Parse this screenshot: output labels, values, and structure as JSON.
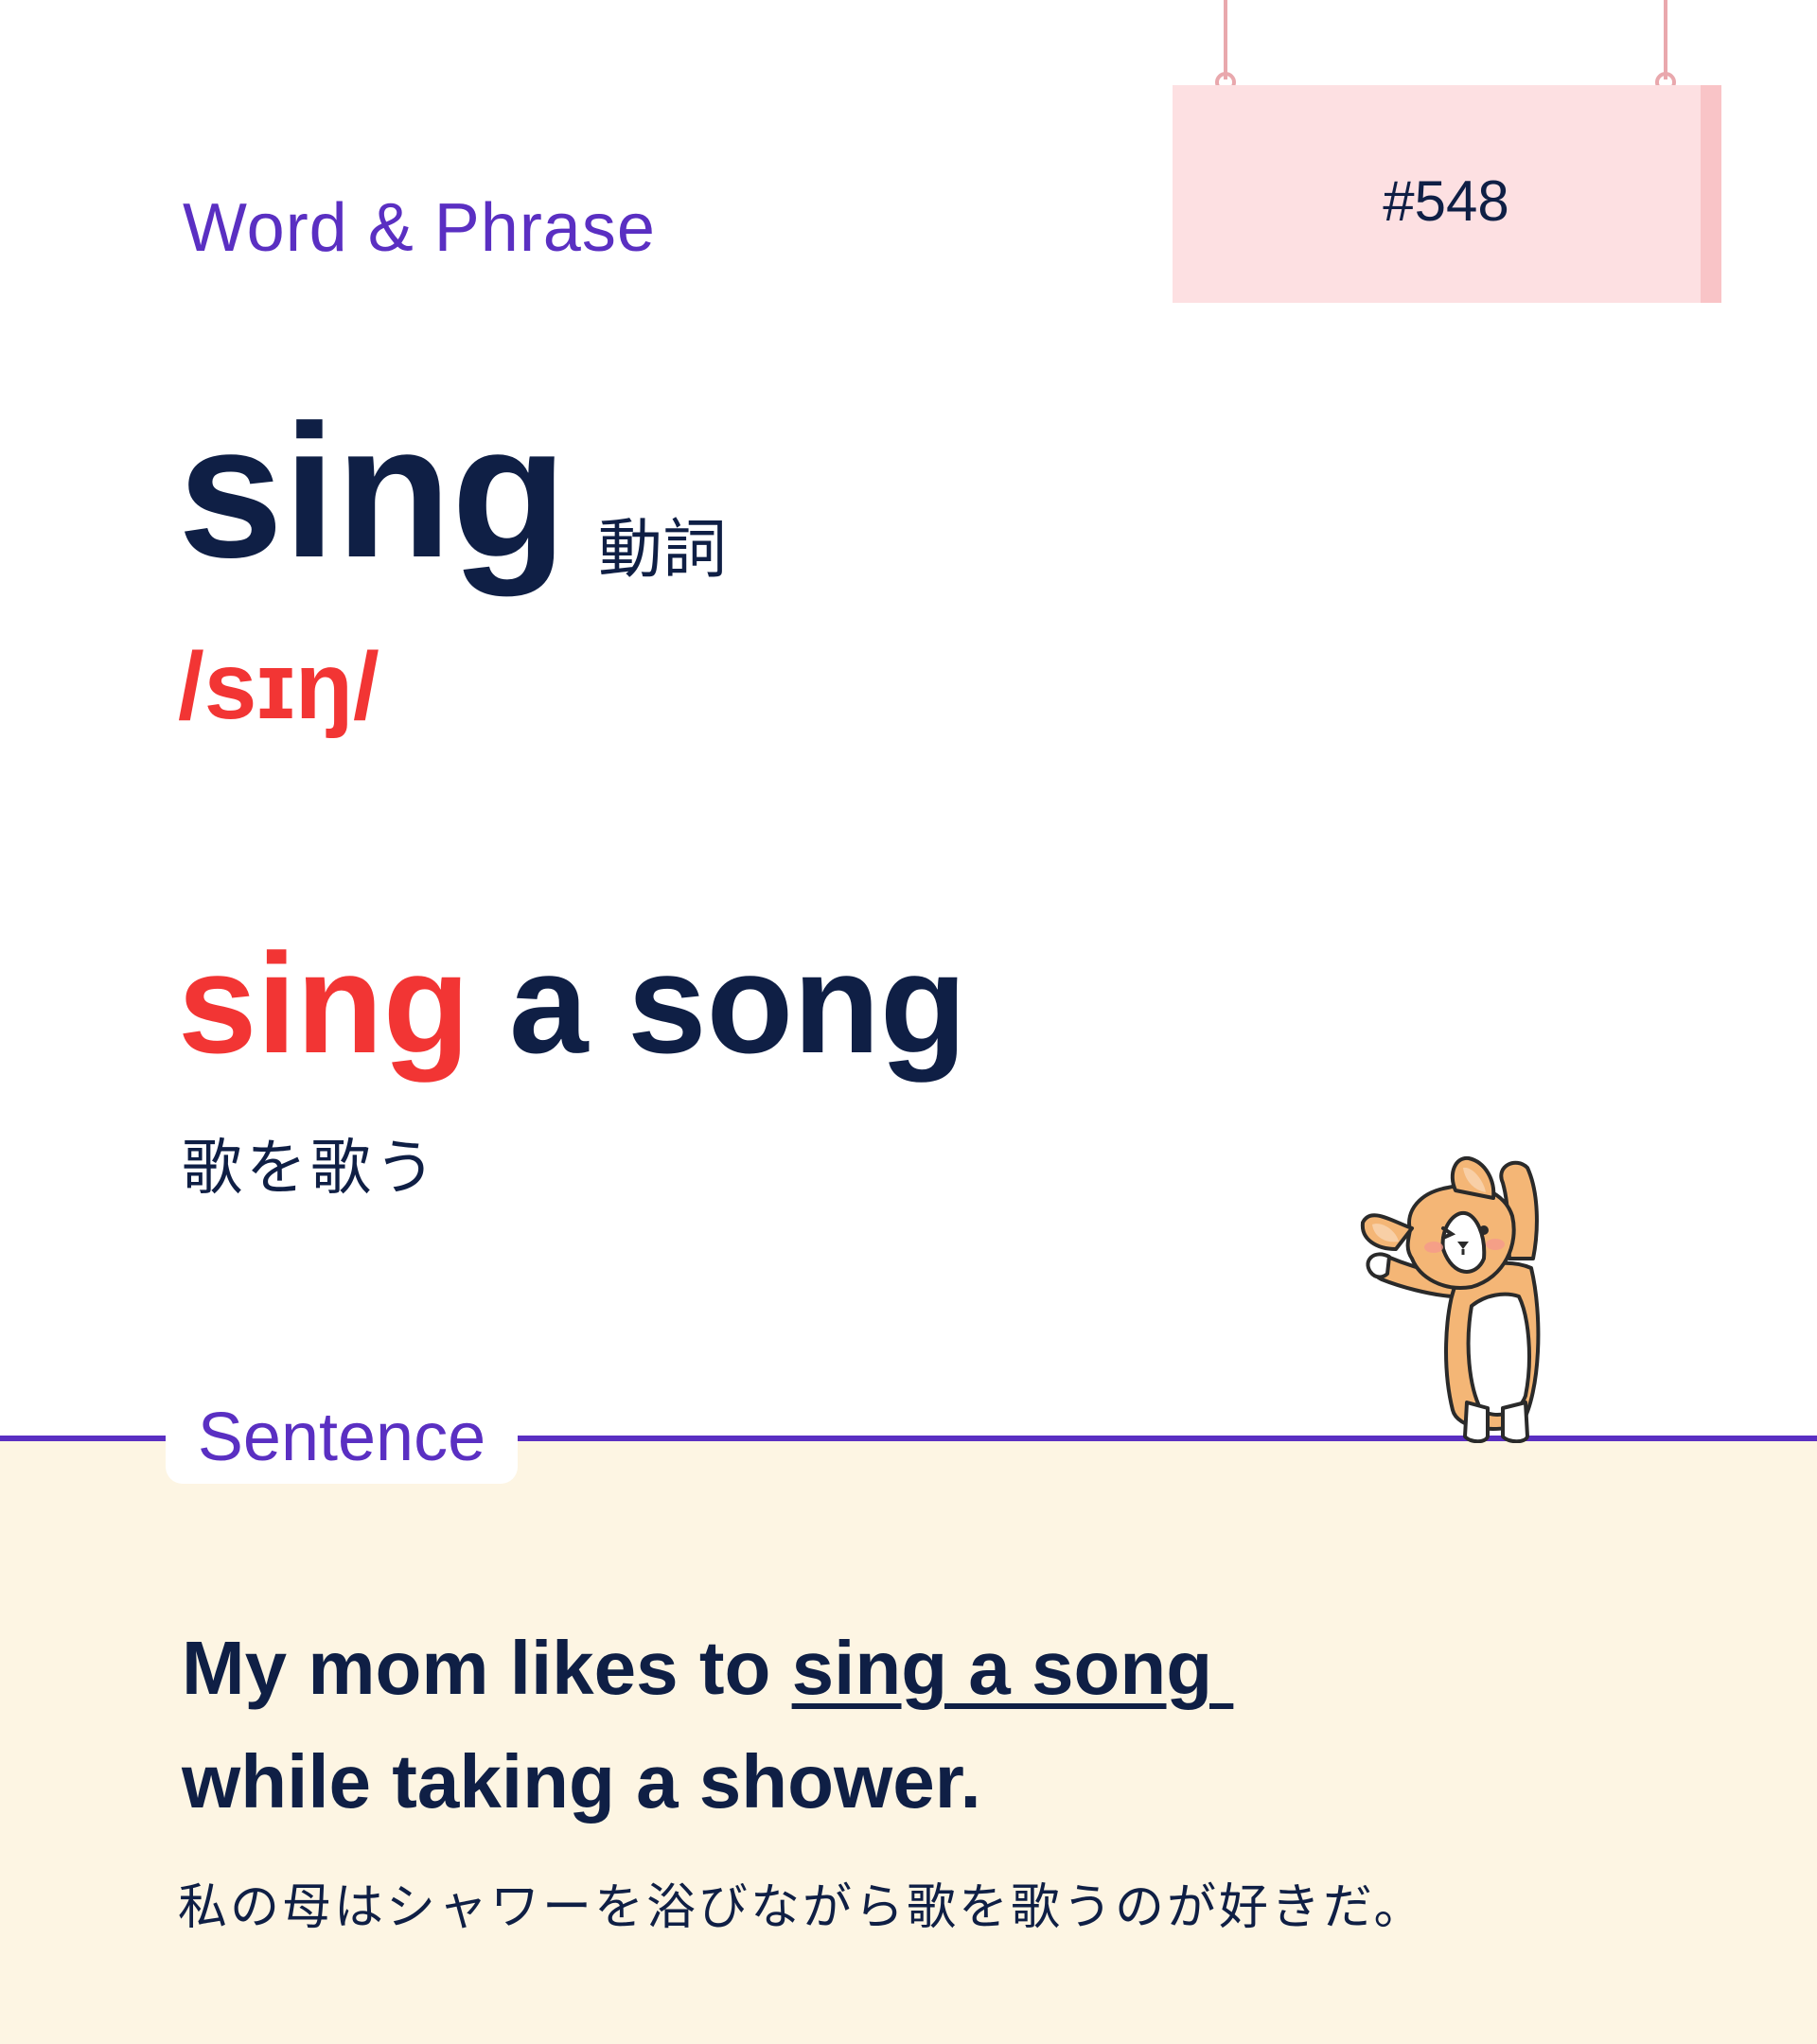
{
  "header": {
    "section_title": "Word & Phrase",
    "number_label": "#548"
  },
  "word": {
    "headword": "sing",
    "part_of_speech": "動詞",
    "pronunciation": "/sɪŋ/"
  },
  "phrase": {
    "highlight": "sing",
    "rest": " a song",
    "translation": "歌を歌う"
  },
  "sentence": {
    "section_label": "Sentence",
    "line1_before": "My mom likes to ",
    "line1_underlined": "sing a song ",
    "line2": "while taking a shower.",
    "translation": "私の母はシャワーを浴びながら歌を歌うのが好きだ。"
  },
  "colors": {
    "accent_purple": "#5a2fc2",
    "text_navy": "#0f1f45",
    "highlight_red": "#f23534",
    "sign_pink": "#fde0e2",
    "sentence_bg": "#fdf5e3"
  },
  "icons": {
    "mascot": "corgi-mascot-icon"
  }
}
